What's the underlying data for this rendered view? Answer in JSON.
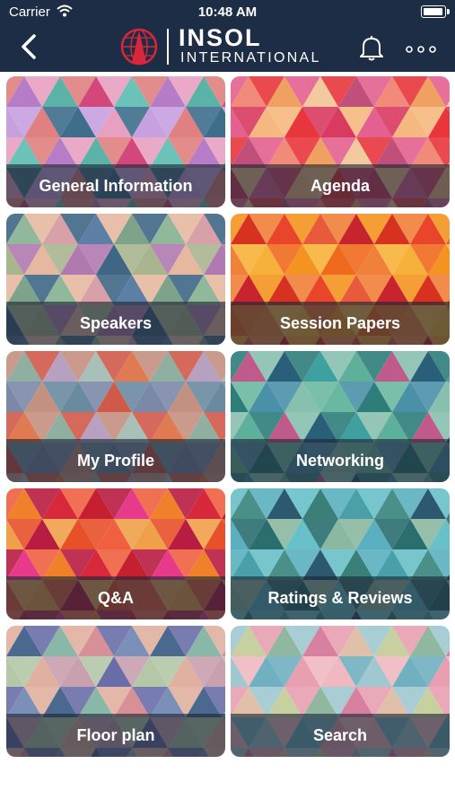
{
  "status_bar": {
    "carrier": "Carrier",
    "time": "10:48 AM"
  },
  "header": {
    "back_icon": "chevron-left-icon",
    "logo_top": "INSOL",
    "logo_bottom": "INTERNATIONAL",
    "bell_icon": "bell-icon",
    "more_icon": "more-dots-icon",
    "background_color": "#1c2d45"
  },
  "tiles": [
    {
      "label": "General Information",
      "palette": [
        "#d4477a",
        "#e8a0c0",
        "#5bb3a8",
        "#3d6e8c",
        "#b77cc8",
        "#e08080",
        "#6ac2b8",
        "#c7a0e0"
      ]
    },
    {
      "label": "Agenda",
      "palette": [
        "#e8363c",
        "#f28a7a",
        "#f5b880",
        "#c0507a",
        "#e46090",
        "#f3c9a0",
        "#d83a60",
        "#f0a060"
      ]
    },
    {
      "label": "Speakers",
      "palette": [
        "#7fa38a",
        "#a8b58f",
        "#5d7fa6",
        "#3f6685",
        "#d8a0a8",
        "#b07ab0",
        "#91b89a",
        "#e6b8a0"
      ]
    },
    {
      "label": "Session Papers",
      "palette": [
        "#f06a1e",
        "#e8452a",
        "#f4931f",
        "#d73220",
        "#f7b13a",
        "#c8242e",
        "#f0803a",
        "#e85a3c"
      ]
    },
    {
      "label": "My Profile",
      "palette": [
        "#8fb0a0",
        "#c49080",
        "#e07a50",
        "#7c88a8",
        "#a8c0b8",
        "#d05a4a",
        "#b8a0c0",
        "#6a8aa0"
      ]
    },
    {
      "label": "Networking",
      "palette": [
        "#2e7d7a",
        "#3fa0a0",
        "#6ab8a0",
        "#2a5f7a",
        "#88c0b0",
        "#c05a8a",
        "#4a90a8",
        "#5fb09a"
      ]
    },
    {
      "label": "Q&A",
      "palette": [
        "#d8283c",
        "#e8502a",
        "#f0802a",
        "#b81c40",
        "#e83a8a",
        "#f0a04a",
        "#c42030",
        "#f06040"
      ]
    },
    {
      "label": "Ratings & Reviews",
      "palette": [
        "#2a6e70",
        "#4aa0a8",
        "#5ab0c0",
        "#3a8078",
        "#8ab8a0",
        "#2c5870",
        "#68c0c8",
        "#4a9088"
      ]
    },
    {
      "label": "Floor plan",
      "palette": [
        "#d89098",
        "#6a6ea8",
        "#8ab8a8",
        "#c8a0b0",
        "#4a6890",
        "#e0b0a0",
        "#7a90b8",
        "#b4c8a8"
      ]
    },
    {
      "label": "Search",
      "palette": [
        "#e8a0b0",
        "#c8d0a0",
        "#70b0c0",
        "#e0c0a8",
        "#a0c8d0",
        "#d880a0",
        "#f0b8c0",
        "#90b8a0"
      ]
    }
  ]
}
